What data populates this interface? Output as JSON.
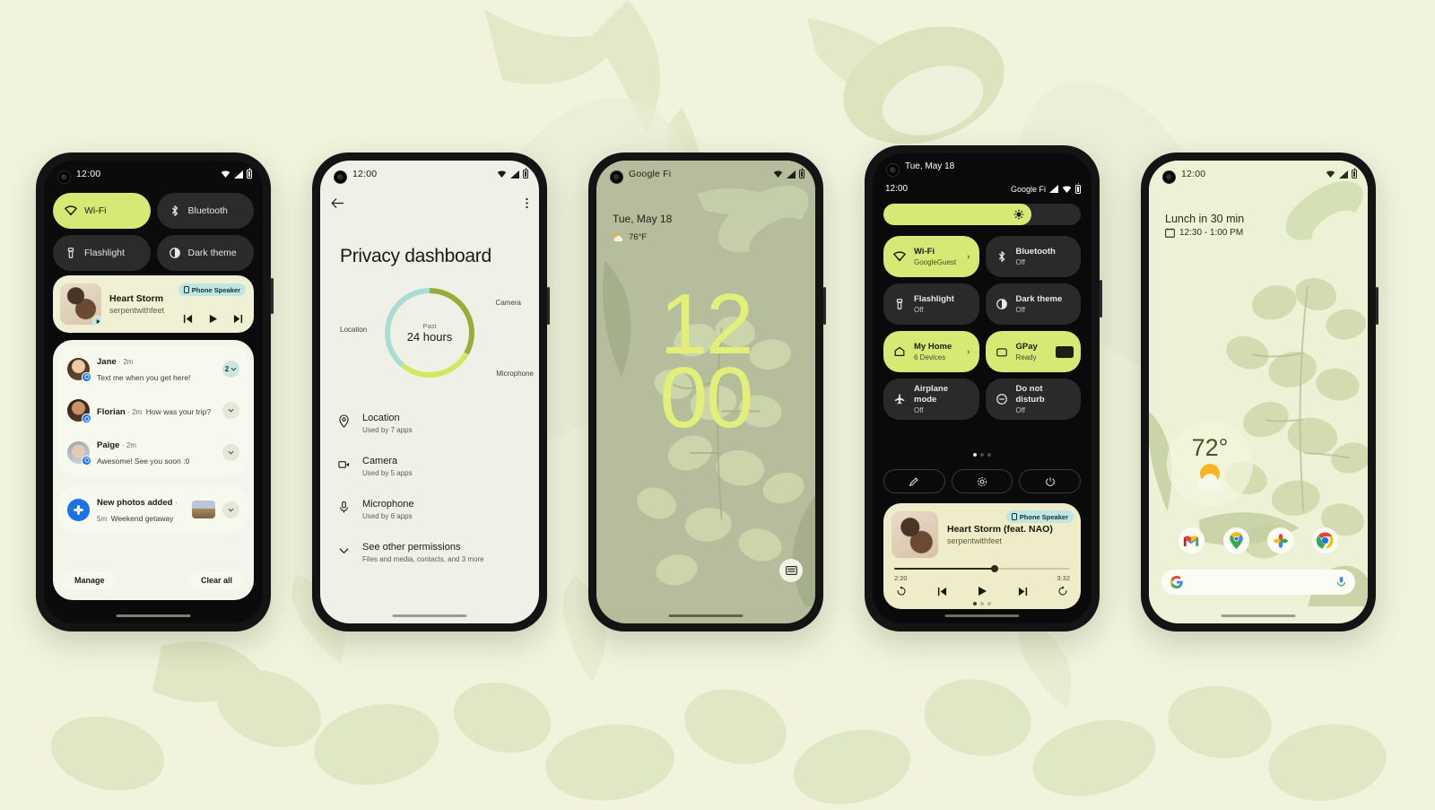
{
  "page": {
    "background_color": "#f1f3dd",
    "accent_color": "#d5ea74",
    "clock_color": "#e2f07a"
  },
  "phone1": {
    "name": "notification-shade",
    "statusbar": {
      "time": "12:00",
      "icons": [
        "wifi-icon",
        "signal-icon",
        "battery-icon"
      ]
    },
    "quick_settings": [
      {
        "label": "Wi-Fi",
        "icon": "wifi-icon",
        "state": "on"
      },
      {
        "label": "Bluetooth",
        "icon": "bluetooth-icon",
        "state": "off"
      },
      {
        "label": "Flashlight",
        "icon": "flashlight-icon",
        "state": "off"
      },
      {
        "label": "Dark theme",
        "icon": "dark-theme-icon",
        "state": "off"
      }
    ],
    "media": {
      "title": "Heart Storm",
      "artist": "serpentwithfeet",
      "output_chip": "Phone Speaker",
      "controls": [
        "previous-track",
        "play",
        "next-track"
      ]
    },
    "notifications": [
      {
        "name": "Jane",
        "time": "2m",
        "message": "Text me when you get here!",
        "badge": "2"
      },
      {
        "name": "Florian",
        "time": "2m",
        "message": "How was your trip?",
        "badge": ""
      },
      {
        "name": "Paige",
        "time": "2m",
        "message": "Awesome! See you soon :0",
        "badge": ""
      }
    ],
    "photo_notification": {
      "title": "New photos added",
      "time": "5m",
      "message": "Weekend getaway"
    },
    "actions": {
      "manage": "Manage",
      "clear_all": "Clear all"
    }
  },
  "phone2": {
    "name": "privacy-dashboard",
    "statusbar": {
      "time": "12:00"
    },
    "title": "Privacy dashboard",
    "donut_center": {
      "caption": "Past",
      "duration": "24 hours"
    },
    "labels": {
      "location": "Location",
      "camera": "Camera",
      "microphone": "Microphone"
    },
    "chart_data": {
      "type": "pie",
      "title": "Privacy dashboard usage, past 24 hours",
      "categories": [
        "Camera",
        "Microphone",
        "Location"
      ],
      "values": [
        33,
        28,
        39
      ],
      "colors": [
        "#9bab3a",
        "#d4e85f",
        "#a9ddd4"
      ],
      "legend_position": "around-donut"
    },
    "permissions": [
      {
        "name": "Location",
        "sub": "Used by 7 apps",
        "icon": "location-pin-icon"
      },
      {
        "name": "Camera",
        "sub": "Used by 5 apps",
        "icon": "camera-icon"
      },
      {
        "name": "Microphone",
        "sub": "Used by 6 apps",
        "icon": "microphone-icon"
      },
      {
        "name": "See other permissions",
        "sub": "Files and media, contacts, and 3 more",
        "icon": "chevron-down-icon"
      }
    ]
  },
  "phone3": {
    "name": "lock-screen",
    "statusbar": {
      "carrier": "Google Fi"
    },
    "date": "Tue, May 18",
    "weather": "76°F",
    "clock_hours": "12",
    "clock_minutes": "00",
    "wallet_icon": "wallet-icon"
  },
  "phone4": {
    "name": "quick-settings-expanded",
    "date": "Tue, May 18",
    "time": "12:00",
    "carrier": "Google Fi",
    "brightness_percent": 75,
    "tiles": [
      {
        "label": "Wi-Fi",
        "sub": "GoogleGuest",
        "icon": "wifi-icon",
        "state": "on",
        "arrow": true
      },
      {
        "label": "Bluetooth",
        "sub": "Off",
        "icon": "bluetooth-icon",
        "state": "off",
        "arrow": false
      },
      {
        "label": "Flashlight",
        "sub": "Off",
        "icon": "flashlight-icon",
        "state": "off",
        "arrow": false
      },
      {
        "label": "Dark theme",
        "sub": "Off",
        "icon": "dark-theme-icon",
        "state": "off",
        "arrow": false
      },
      {
        "label": "My Home",
        "sub": "6 Devices",
        "icon": "home-icon",
        "state": "on",
        "arrow": true
      },
      {
        "label": "GPay",
        "sub": "Ready",
        "icon": "wallet-icon",
        "state": "on",
        "arrow": false
      },
      {
        "label": "Airplane mode",
        "sub": "Off",
        "icon": "airplane-icon",
        "state": "off",
        "arrow": false
      },
      {
        "label": "Do not disturb",
        "sub": "Off",
        "icon": "do-not-disturb-icon",
        "state": "off",
        "arrow": false
      }
    ],
    "footer_buttons": [
      "edit-icon",
      "settings-gear-icon",
      "power-icon"
    ],
    "media": {
      "title": "Heart Storm (feat. NAO)",
      "artist": "serpentwithfeet",
      "output_chip": "Phone Speaker",
      "elapsed": "2:20",
      "total": "3:32",
      "progress_percent": 57,
      "controls": [
        "replay-10",
        "previous-track",
        "play",
        "next-track",
        "forward-30"
      ]
    }
  },
  "phone5": {
    "name": "home-screen",
    "statusbar": {
      "time": "12:00"
    },
    "at_a_glance": {
      "title": "Lunch in 30 min",
      "time_range": "12:30 - 1:00 PM"
    },
    "weather_widget": {
      "temperature": "72°",
      "condition": "partly-sunny"
    },
    "apps": [
      {
        "name": "Gmail",
        "icon": "gmail-icon"
      },
      {
        "name": "Maps",
        "icon": "maps-icon"
      },
      {
        "name": "Photos",
        "icon": "photos-icon"
      },
      {
        "name": "Chrome",
        "icon": "chrome-icon"
      }
    ],
    "search": {
      "icon": "google-g-icon",
      "mic": "microphone-icon",
      "placeholder": ""
    }
  }
}
